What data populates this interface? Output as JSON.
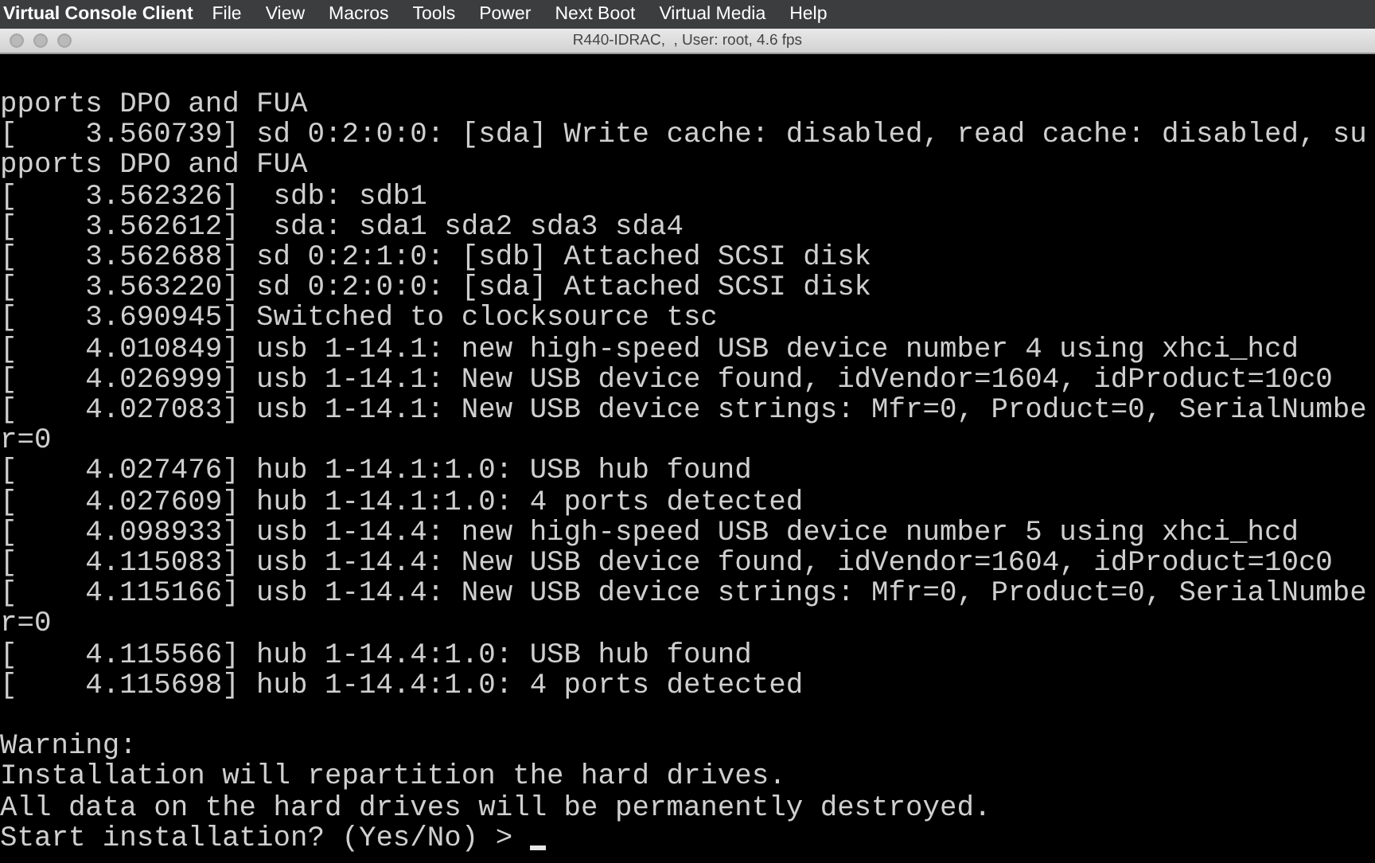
{
  "menu_bar": {
    "app_name": "Virtual Console Client",
    "items": [
      "File",
      "View",
      "Macros",
      "Tools",
      "Power",
      "Next Boot",
      "Virtual Media",
      "Help"
    ]
  },
  "window": {
    "title": "R440-IDRAC,  , User: root, 4.6 fps"
  },
  "console": {
    "log_lines": [
      "pports DPO and FUA",
      "[    3.560739] sd 0:2:0:0: [sda] Write cache: disabled, read cache: disabled, su",
      "pports DPO and FUA",
      "[    3.562326]  sdb: sdb1",
      "[    3.562612]  sda: sda1 sda2 sda3 sda4",
      "[    3.562688] sd 0:2:1:0: [sdb] Attached SCSI disk",
      "[    3.563220] sd 0:2:0:0: [sda] Attached SCSI disk",
      "[    3.690945] Switched to clocksource tsc",
      "[    4.010849] usb 1-14.1: new high-speed USB device number 4 using xhci_hcd",
      "[    4.026999] usb 1-14.1: New USB device found, idVendor=1604, idProduct=10c0",
      "[    4.027083] usb 1-14.1: New USB device strings: Mfr=0, Product=0, SerialNumbe",
      "r=0",
      "[    4.027476] hub 1-14.1:1.0: USB hub found",
      "[    4.027609] hub 1-14.1:1.0: 4 ports detected",
      "[    4.098933] usb 1-14.4: new high-speed USB device number 5 using xhci_hcd",
      "[    4.115083] usb 1-14.4: New USB device found, idVendor=1604, idProduct=10c0",
      "[    4.115166] usb 1-14.4: New USB device strings: Mfr=0, Product=0, SerialNumbe",
      "r=0",
      "[    4.115566] hub 1-14.4:1.0: USB hub found",
      "[    4.115698] hub 1-14.4:1.0: 4 ports detected"
    ],
    "warning_lines": [
      "Warning:",
      "Installation will repartition the hard drives.",
      "All data on the hard drives will be permanently destroyed."
    ],
    "prompt": "Start installation? (Yes/No) > "
  }
}
